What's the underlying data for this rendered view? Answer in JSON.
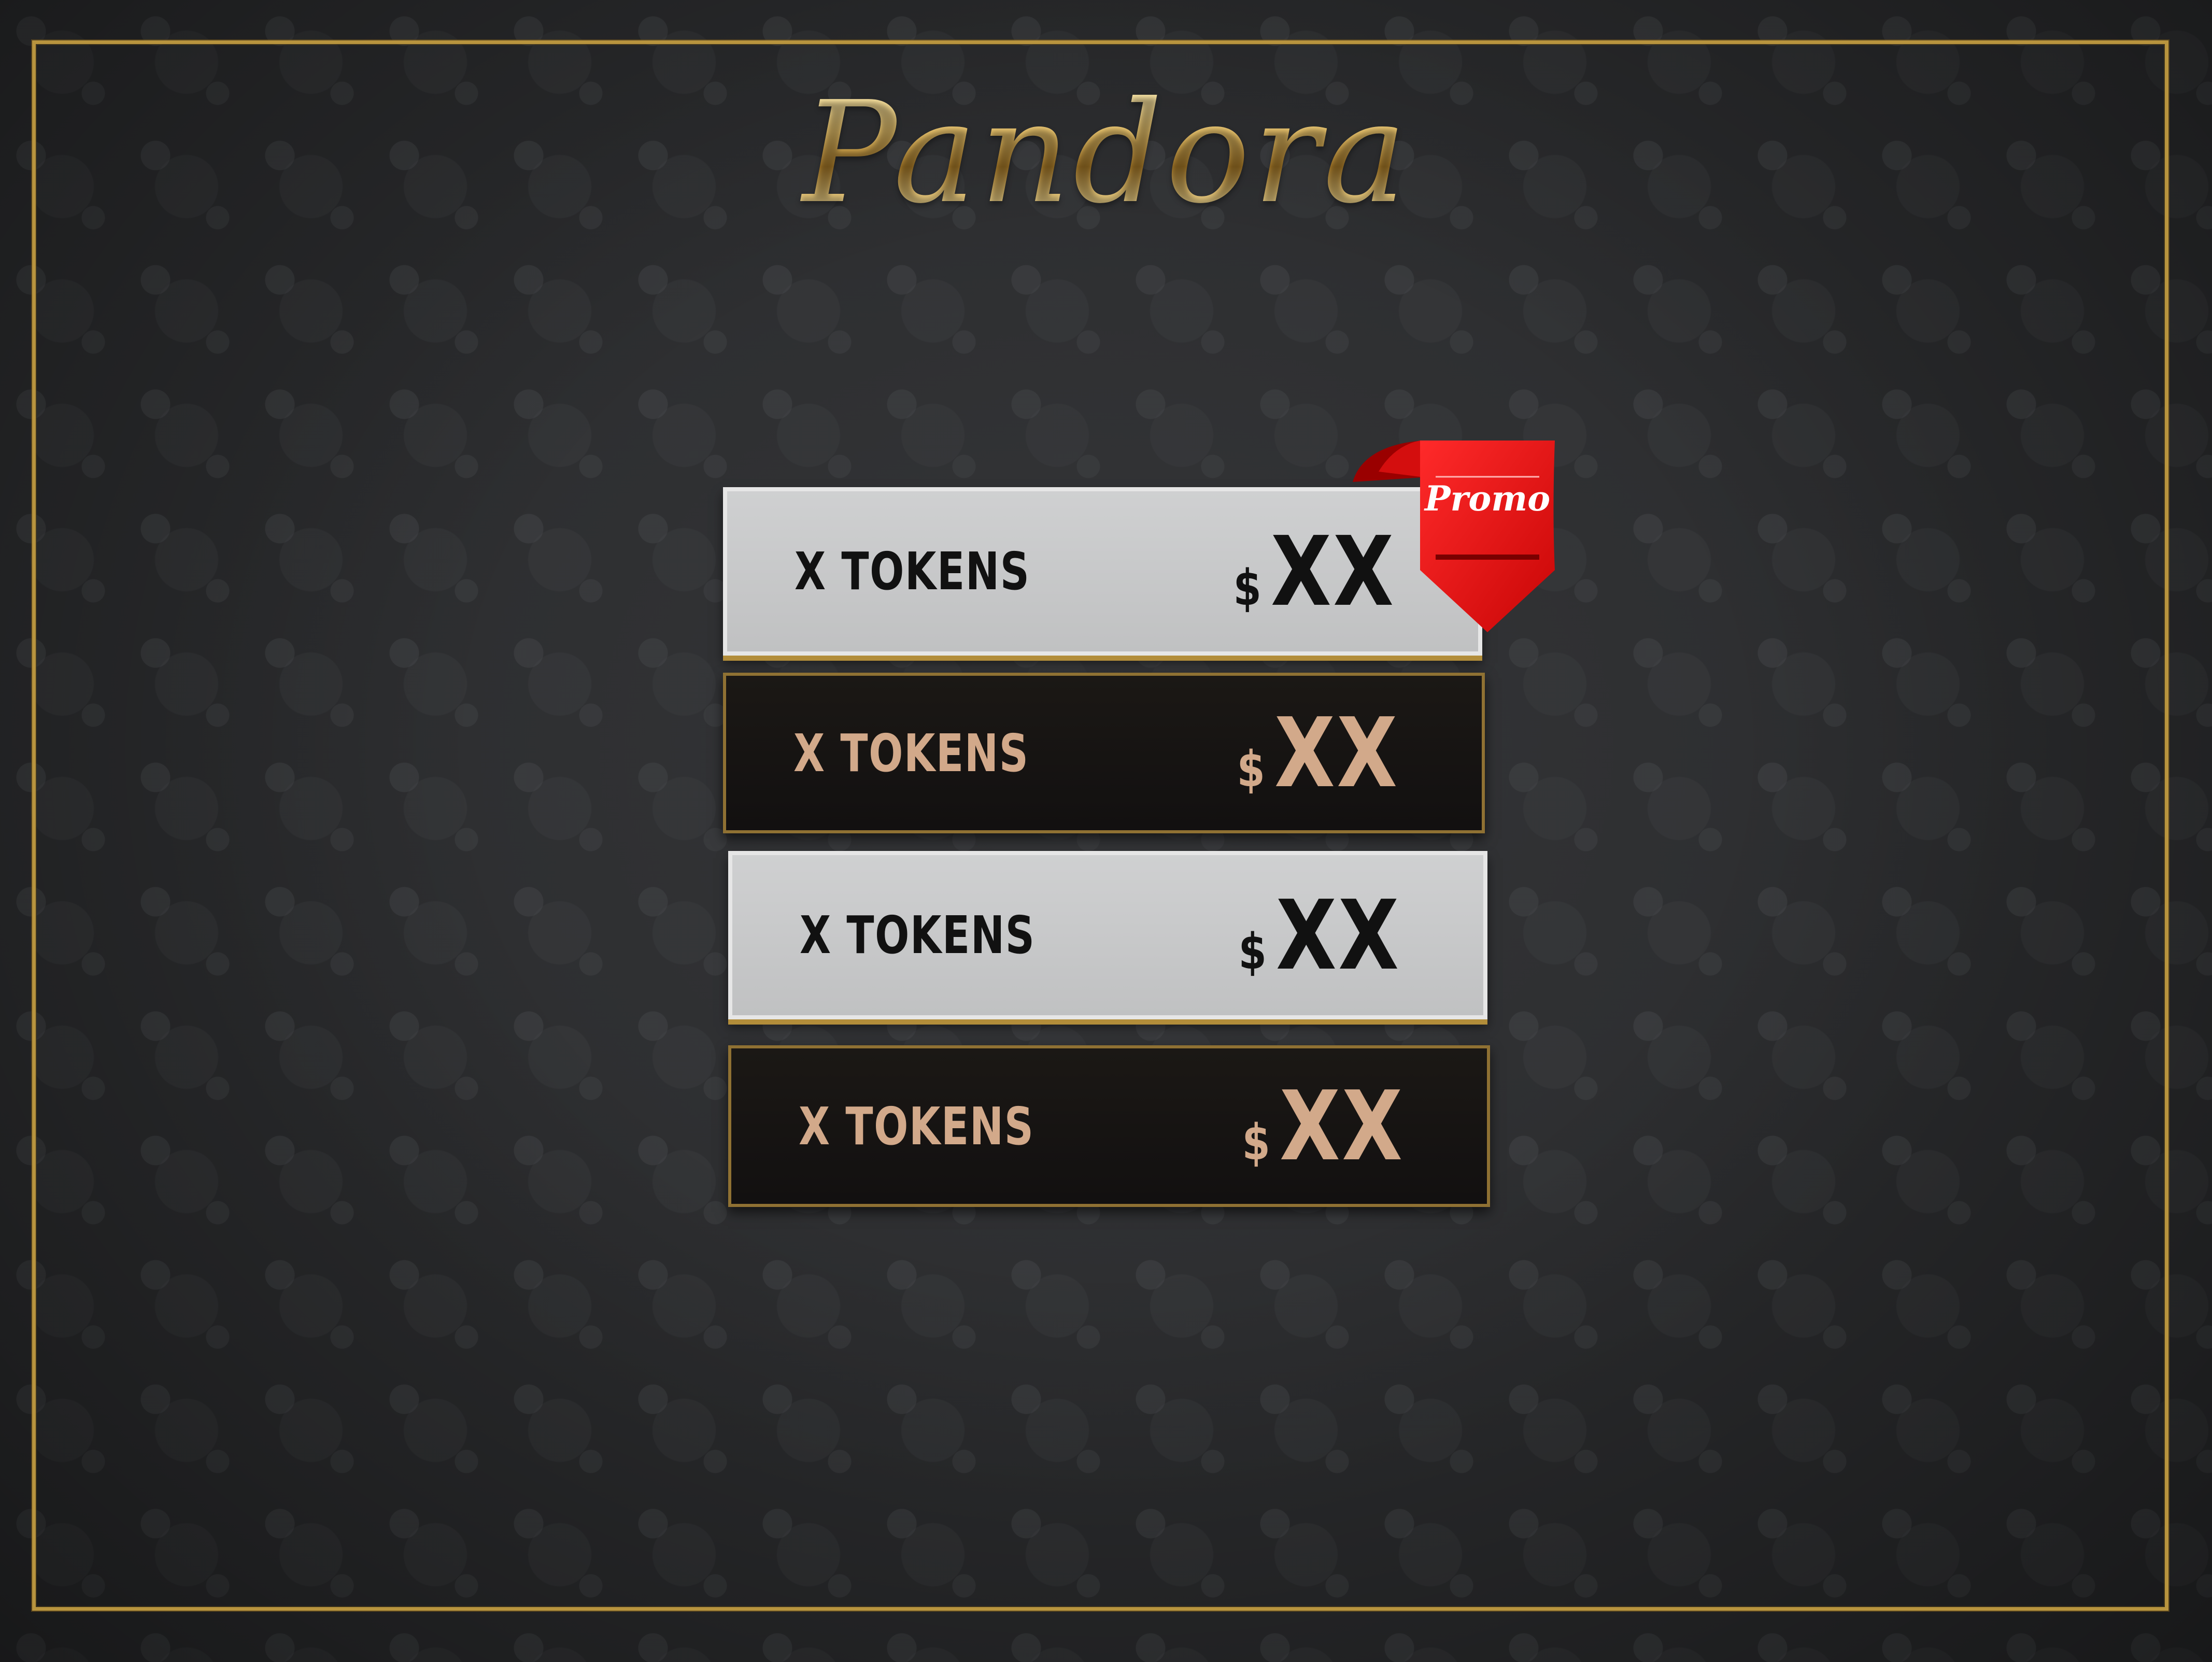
{
  "brand": {
    "logo_text": "Pandora"
  },
  "packages": [
    {
      "tokens_label": "X TOKENS",
      "currency": "$",
      "amount": "XX"
    },
    {
      "tokens_label": "X TOKENS",
      "currency": "$",
      "amount": "XX"
    },
    {
      "tokens_label": "X TOKENS",
      "currency": "$",
      "amount": "XX"
    },
    {
      "tokens_label": "X TOKENS",
      "currency": "$",
      "amount": "XX"
    }
  ],
  "promo": {
    "label": "Promo"
  },
  "colors": {
    "gold": "#b8943e",
    "light_card_text": "#111111",
    "dark_card_text": "#d2a98a",
    "promo_red": "#e01010"
  }
}
